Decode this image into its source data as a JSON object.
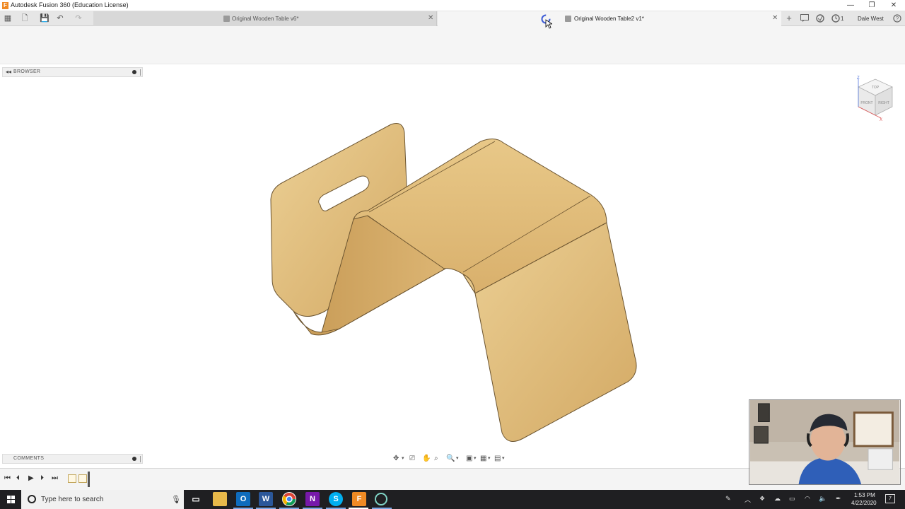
{
  "window": {
    "title": "Autodesk Fusion 360 (Education License)",
    "logo_letter": "F",
    "minimize": "—",
    "restore": "❐",
    "close": "✕"
  },
  "tabs": [
    {
      "label": "Original Wooden Table v6*",
      "active": false,
      "close": "✕"
    },
    {
      "label": "Original Wooden Table2 v1*",
      "active": true,
      "close": "✕"
    }
  ],
  "toolbar": {
    "grid_icon": "▦",
    "file_icon": "🗋",
    "save_icon": "💾",
    "undo_icon": "↶",
    "redo_icon": "↷",
    "add_tab": "+",
    "job_count": "1",
    "user_name": "Dale West",
    "help": "?"
  },
  "browser_panel": {
    "label": "BROWSER",
    "collapse": "◂◂"
  },
  "comments_panel": {
    "label": "COMMENTS"
  },
  "viewcube": {
    "faces": [
      "TOP",
      "FRONT",
      "RIGHT"
    ],
    "axes": [
      "Z",
      "X"
    ]
  },
  "timeline": {
    "controls": [
      "⏮",
      "⏴",
      "▶",
      "⏵",
      "⏭"
    ]
  },
  "taskbar": {
    "search_placeholder": "Type here to search",
    "mic": "🎙",
    "apps": [
      "Task View",
      "File Explorer",
      "Outlook",
      "Word",
      "Chrome",
      "OneNote",
      "Skype",
      "Fusion 360",
      "Screen Recorder"
    ],
    "clock_time": "1:53 PM",
    "clock_date": "4/22/2020",
    "notification_count": "7"
  },
  "colors": {
    "wood_light": "#e7c98a",
    "wood_mid": "#d8b06a",
    "wood_dark": "#b88a45",
    "accent_orange": "#f08a24"
  }
}
